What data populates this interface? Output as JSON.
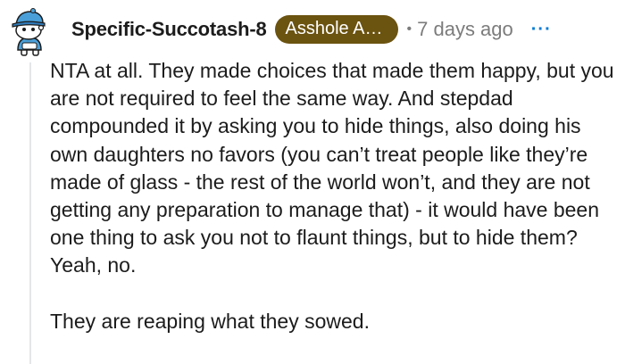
{
  "comment": {
    "author": "Specific-Succotash-8",
    "flair": "Asshole Afici…",
    "separator": "•",
    "time_ago": "7 days ago",
    "more_label": "···",
    "avatar_icon": "snoo-avatar-icon",
    "paragraphs": [
      "NTA at all. They made choices that made them happy, but you are not required to feel the same way. And stepdad compounded it by asking you to hide things, also doing his own daughters no favors (you can’t treat people like they’re made of glass - the rest of the world won’t, and they are not getting any preparation to manage that) - it would have been one thing to ask you not to flaunt things, but to hide them? Yeah, no.",
      "They are reaping what they sowed."
    ]
  },
  "colors": {
    "flair_bg": "#6b5310",
    "meta_text": "#7c7c7c",
    "more_icon": "#0079d3",
    "thread_line": "#e4e6e8"
  }
}
